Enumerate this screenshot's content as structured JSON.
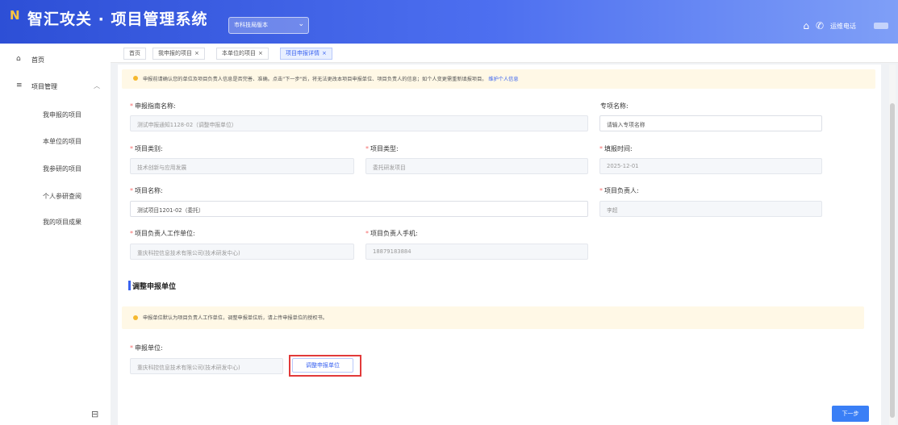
{
  "header": {
    "logo_mark": "N",
    "app_title": "智汇攻关 · 项目管理系统",
    "version_select": "市科技局版本",
    "hotline_label": "运维电话"
  },
  "sidebar": {
    "home_label": "首页",
    "project_mgmt_label": "项目管理",
    "sub_items": [
      "我申报的项目",
      "本单位的项目",
      "我参研的项目",
      "个人参研查阅",
      "我的项目成果"
    ]
  },
  "tabs": [
    {
      "label": "首页",
      "closable": false
    },
    {
      "label": "我申报的项目",
      "closable": true
    },
    {
      "label": "本单位的项目",
      "closable": true
    },
    {
      "label": "项目申报详情",
      "closable": true
    }
  ],
  "notice_top": {
    "text": "申报前请确认您的单位及项目负责人信息是否完善、准确。点击\"下一步\"后，将无法更改本项目申报单位、项目负责人的信息；如个人变更需重新填报项目。",
    "link": "维护个人信息"
  },
  "form": {
    "guide_name": {
      "label": "申报指南名称:",
      "value": "测试申报通知1128-02（调整申报单位）"
    },
    "special_name": {
      "label": "专项名称:",
      "placeholder": "请输入专项名称"
    },
    "project_category": {
      "label": "项目类别:",
      "value": "技术创新与应用发展"
    },
    "project_type": {
      "label": "项目类型:",
      "value": "委托研发项目"
    },
    "fill_date": {
      "label": "填报时间:",
      "value": "2025-12-01"
    },
    "project_name": {
      "label": "项目名称:",
      "value": "测试项目1201-02（委托）"
    },
    "project_leader": {
      "label": "项目负责人:",
      "value": "李超"
    },
    "leader_unit": {
      "label": "项目负责人工作单位:",
      "value": "重庆科控信息技术有限公司(技术研发中心)"
    },
    "leader_phone": {
      "label": "项目负责人手机:",
      "value": "18879183884"
    }
  },
  "section": {
    "title": "调整申报单位",
    "notice": "申报单位默认为项目负责人工作单位，调整申报单位后，请上传申报单位的授权书。",
    "unit_label": "申报单位:",
    "unit_value": "重庆科控信息技术有限公司(技术研发中心)",
    "adjust_button": "调整申报单位"
  },
  "next_button": "下一步",
  "icons": {
    "home": "home-icon",
    "menu": "menu-icon",
    "phone": "phone-icon",
    "shop": "store-icon",
    "collapse": "collapse-icon"
  },
  "colors": {
    "primary": "#3a63f0",
    "header_start": "#2d4fd6",
    "notice_bg": "#fff8e6",
    "highlight_border": "#e23a3a"
  }
}
